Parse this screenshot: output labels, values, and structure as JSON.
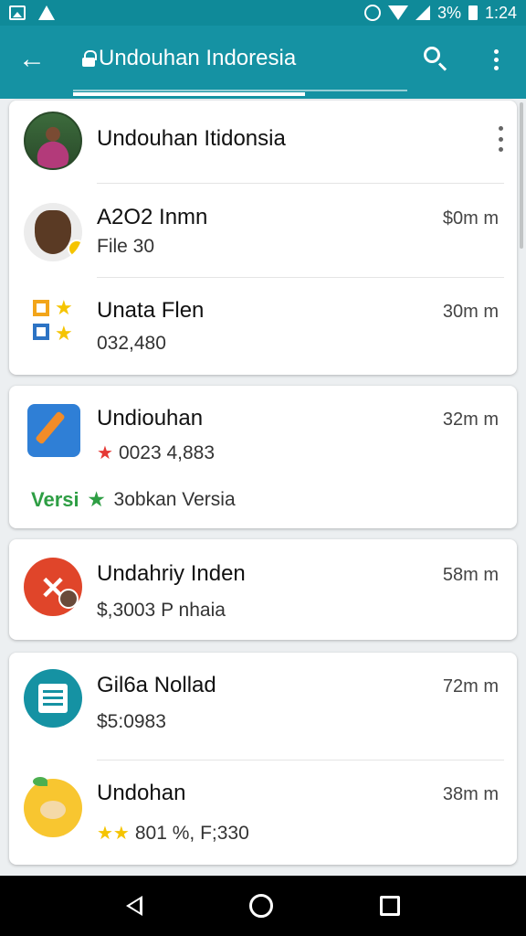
{
  "status_bar": {
    "battery": "3%",
    "time": "1:24",
    "icons": [
      "image-icon",
      "warning-icon",
      "alarm-icon",
      "wifi-icon",
      "signal-icon",
      "battery-icon"
    ]
  },
  "app_bar": {
    "title": "Undouhan Indoresia",
    "icons": [
      "back-arrow-icon",
      "lock-icon",
      "search-icon",
      "more-vert-icon"
    ]
  },
  "card1": {
    "rows": [
      {
        "name": "Undouhan Itidonsia",
        "avatar": "person-avatar",
        "action": "more-vert-icon"
      },
      {
        "name": "A2O2 Inmn",
        "sub": "File 30",
        "time": "$0m m",
        "avatar": "dog-avatar"
      },
      {
        "name": "Unata Flen",
        "sub": "032,480",
        "time": "30m m",
        "avatar": "grid-star-avatar"
      }
    ]
  },
  "card2": {
    "name": "Undiouhan",
    "sub": "0023 4,883",
    "time": "32m m",
    "avatar": "chat-pen-avatar",
    "version_label": "Versi",
    "version_text": "3obkan Versia"
  },
  "card3": {
    "name": "Undahriy Inden",
    "sub": "$,3003 P nhaia",
    "time": "58m m",
    "avatar": "x-bear-avatar"
  },
  "card4": {
    "rows": [
      {
        "name": "Gil6a Nollad",
        "sub": "$5:0983",
        "time": "72m m",
        "avatar": "notepad-avatar"
      },
      {
        "name": "Undohan",
        "sub": "801 %, F;330",
        "time": "38m m",
        "avatar": "orange-face-avatar"
      }
    ]
  },
  "colors": {
    "status_bar": "#0f8a99",
    "app_bar": "#1592a3",
    "background": "#eceff1",
    "star_red": "#e53935",
    "star_green": "#2e9e44",
    "star_gold": "#f5c400"
  }
}
